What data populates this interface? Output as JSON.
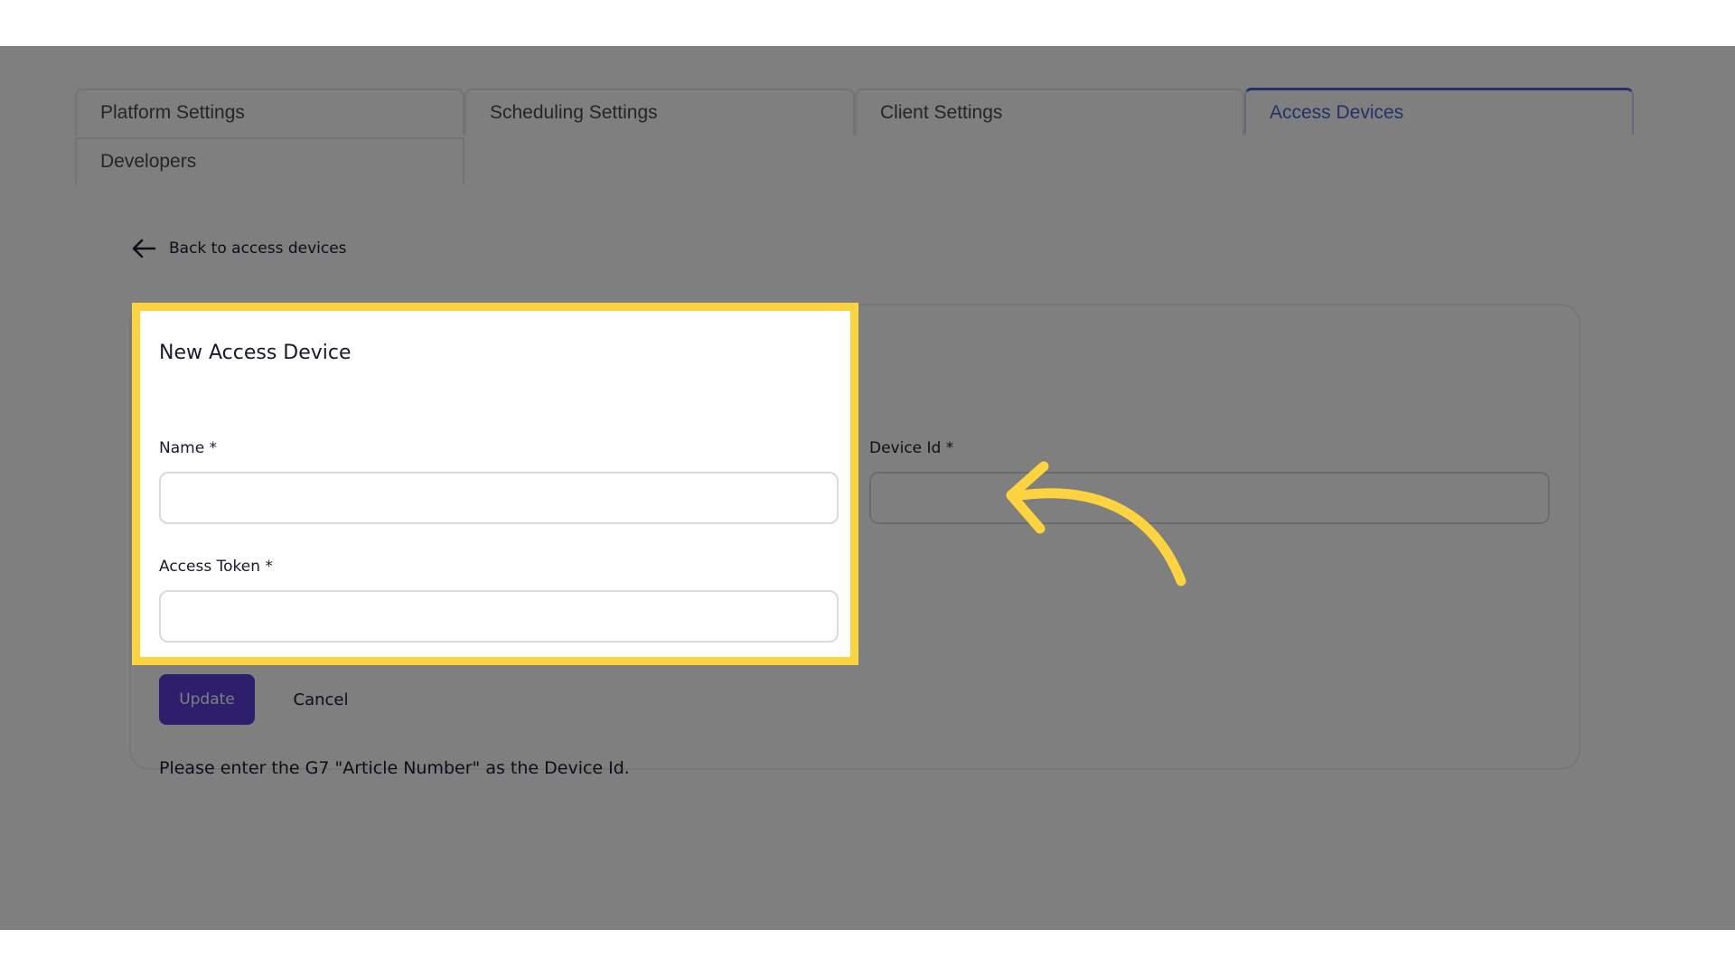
{
  "tabs": {
    "platform": "Platform Settings",
    "scheduling": "Scheduling Settings",
    "client": "Client Settings",
    "access": "Access Devices",
    "developers": "Developers"
  },
  "back_link": {
    "label": "Back to access devices",
    "icon": "arrow-left-icon"
  },
  "form": {
    "title": "New Access Device",
    "name_label": "Name *",
    "name_value": "",
    "token_label": "Access Token *",
    "token_value": "",
    "device_id_label": "Device Id *",
    "device_id_value": "",
    "update_label": "Update",
    "cancel_label": "Cancel",
    "helper_text": "Please enter the G7 \"Article Number\" as the Device Id."
  },
  "highlight": {
    "color": "#fdd440",
    "pointer_icon": "curved-arrow-icon"
  },
  "colors": {
    "accent": "#4d5fd6",
    "primary_button": "#5a3fd9",
    "overlay": "rgba(0,0,0,0.5)"
  }
}
